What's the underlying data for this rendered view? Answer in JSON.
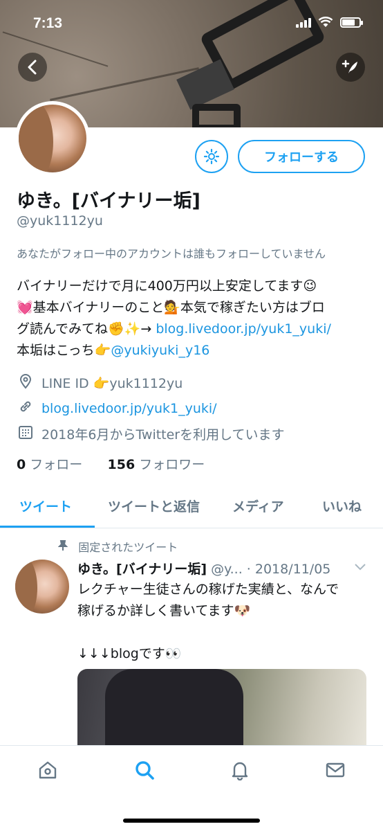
{
  "status_bar": {
    "time": "7:13"
  },
  "header": {
    "back_icon": "chevron-left-icon",
    "compose_icon": "compose-tweet-icon"
  },
  "profile": {
    "name": "ゆき。[バイナリー垢]",
    "handle": "@yuk1112yu",
    "follow_button_label": "フォローする",
    "settings_icon": "gear-icon",
    "follow_note": "あなたがフォロー中のアカウントは誰もフォローしていません",
    "bio": {
      "line1": "バイナリーだけで月に400万円以上安定してます😉",
      "line2": "💓基本バイナリーのこと💁本気で稼ぎたい方はブロ",
      "line3_prefix": "グ読んでみてね✊✨→ ",
      "line3_link": "blog.livedoor.jp/yuk1_yuki/",
      "line4_prefix": "本垢はこっち👉",
      "line4_link": "@yukiyuki_y16"
    },
    "location": "LINE ID 👉yuk1112yu",
    "website": "blog.livedoor.jp/yuk1_yuki/",
    "joined": "2018年6月からTwitterを利用しています",
    "following_count": "0",
    "following_label": "フォロー",
    "followers_count": "156",
    "followers_label": "フォロワー"
  },
  "tabs": [
    {
      "label": "ツイート",
      "active": true
    },
    {
      "label": "ツイートと返信",
      "active": false
    },
    {
      "label": "メディア",
      "active": false
    },
    {
      "label": "いいね",
      "active": false
    }
  ],
  "pinned_tweet": {
    "pinned_label": "固定されたツイート",
    "author_name": "ゆき。[バイナリー垢]",
    "author_handle": "@y...",
    "date": "· 2018/11/05",
    "text_line1": "レクチャー生徒さんの稼げた実績と、なんで",
    "text_line2": "稼げるか詳しく書いてます🐶",
    "text_line3": "↓↓↓blogです👀"
  },
  "bottom_nav": [
    {
      "icon": "home-icon",
      "active": false
    },
    {
      "icon": "search-icon",
      "active": true
    },
    {
      "icon": "notifications-icon",
      "active": false
    },
    {
      "icon": "messages-icon",
      "active": false
    }
  ],
  "colors": {
    "accent": "#1da1f2",
    "link": "#1b95e0",
    "secondary_text": "#657786"
  }
}
